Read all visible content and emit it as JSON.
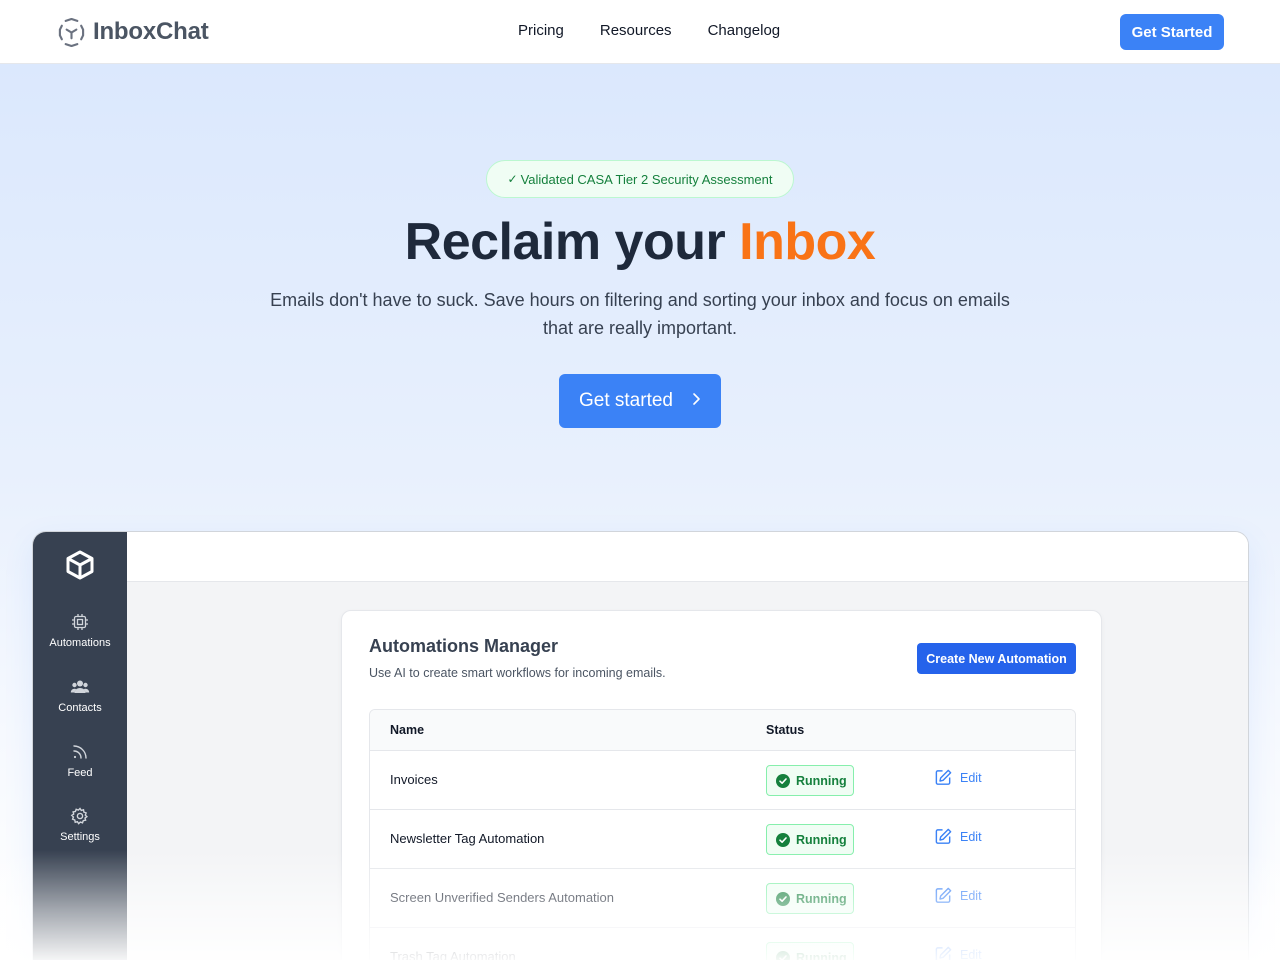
{
  "header": {
    "brand": "InboxChat",
    "nav": [
      "Pricing",
      "Resources",
      "Changelog"
    ],
    "cta": "Get Started"
  },
  "hero": {
    "badge": "Validated CASA Tier 2 Security Assessment",
    "title_main": "Reclaim your ",
    "title_accent": "Inbox",
    "subtitle": "Emails don't have to suck. Save hours on filtering and sorting your inbox and focus on emails that are really important.",
    "cta": "Get started"
  },
  "app": {
    "sidebar": [
      {
        "label": "Automations",
        "icon": "cpu-icon"
      },
      {
        "label": "Contacts",
        "icon": "users-icon"
      },
      {
        "label": "Feed",
        "icon": "rss-icon"
      },
      {
        "label": "Settings",
        "icon": "gear-icon"
      }
    ],
    "card": {
      "title": "Automations Manager",
      "description": "Use AI to create smart workflows for incoming emails.",
      "create_button": "Create New Automation",
      "columns": [
        "Name",
        "Status"
      ],
      "rows": [
        {
          "name": "Invoices",
          "status": "Running",
          "action": "Edit"
        },
        {
          "name": "Newsletter Tag Automation",
          "status": "Running",
          "action": "Edit"
        },
        {
          "name": "Screen Unverified Senders Automation",
          "status": "Running",
          "action": "Edit"
        },
        {
          "name": "Trash Tag Automation",
          "status": "Running",
          "action": "Edit"
        }
      ]
    }
  },
  "colors": {
    "primary": "#3b82f6",
    "accent": "#f97316",
    "success": "#15803d",
    "sidebar": "#374151",
    "title": "#1e293b"
  }
}
